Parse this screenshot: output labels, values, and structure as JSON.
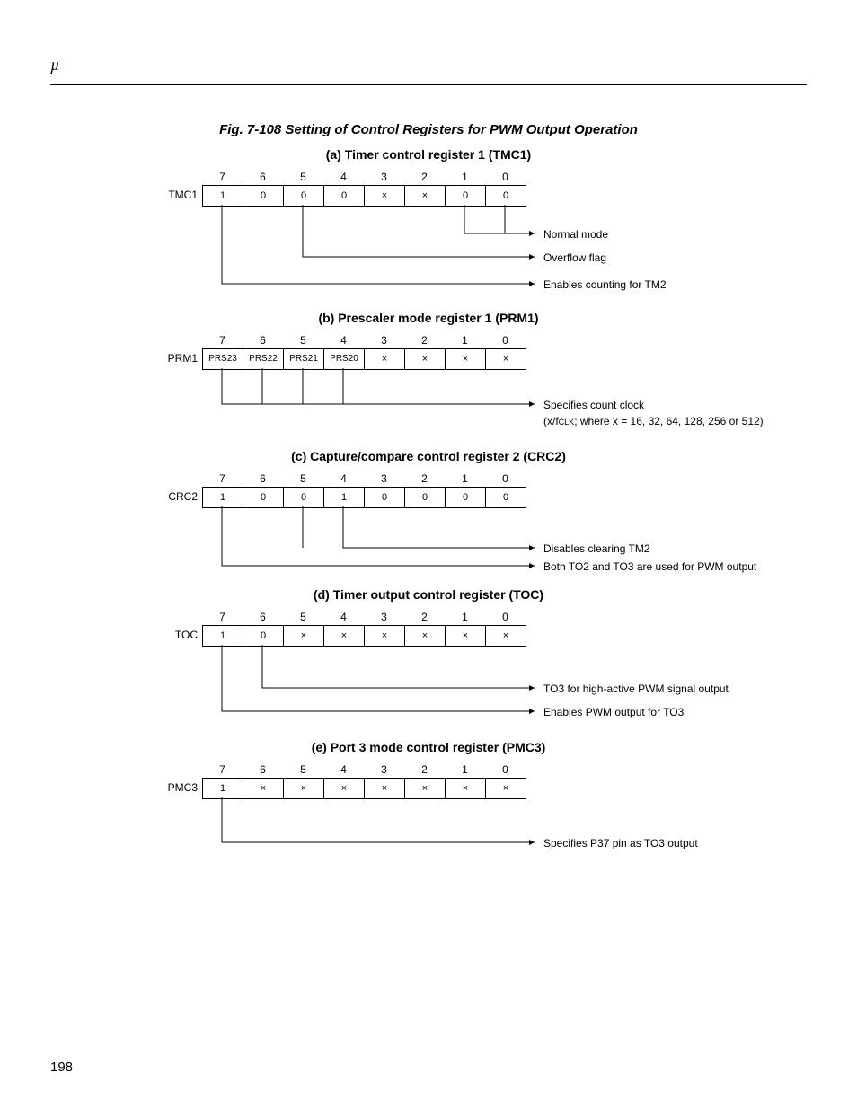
{
  "mu": "µ",
  "page_number": "198",
  "fig_title": "Fig. 7-108  Setting of Control Registers for PWM Output Operation",
  "sections": {
    "a": {
      "title": "(a)  Timer control register 1 (TMC1)",
      "label": "TMC1",
      "bitnums": [
        "7",
        "6",
        "5",
        "4",
        "3",
        "2",
        "1",
        "0"
      ],
      "cells": [
        "1",
        "0",
        "0",
        "0",
        "×",
        "×",
        "0",
        "0"
      ],
      "annots": [
        "Normal mode",
        "Overflow flag",
        "Enables counting for TM2"
      ]
    },
    "b": {
      "title": "(b)  Prescaler mode register 1 (PRM1)",
      "label": "PRM1",
      "bitnums": [
        "7",
        "6",
        "5",
        "4",
        "3",
        "2",
        "1",
        "0"
      ],
      "cells": [
        "PRS23",
        "PRS22",
        "PRS21",
        "PRS20",
        "×",
        "×",
        "×",
        "×"
      ],
      "annots": [
        "Specifies count clock"
      ],
      "annot_sub_prefix": "(x/f",
      "annot_sub_clk": "CLK",
      "annot_sub_suffix": "; where x = 16, 32, 64, 128, 256 or 512)"
    },
    "c": {
      "title": "(c)  Capture/compare control register 2 (CRC2)",
      "label": "CRC2",
      "bitnums": [
        "7",
        "6",
        "5",
        "4",
        "3",
        "2",
        "1",
        "0"
      ],
      "cells": [
        "1",
        "0",
        "0",
        "1",
        "0",
        "0",
        "0",
        "0"
      ],
      "annots": [
        "Disables clearing TM2",
        "Both TO2 and TO3 are used for PWM output"
      ]
    },
    "d": {
      "title": "(d)  Timer output control register (TOC)",
      "label": "TOC",
      "bitnums": [
        "7",
        "6",
        "5",
        "4",
        "3",
        "2",
        "1",
        "0"
      ],
      "cells": [
        "1",
        "0",
        "×",
        "×",
        "×",
        "×",
        "×",
        "×"
      ],
      "annots": [
        "TO3 for high-active PWM signal output",
        "Enables PWM output for TO3"
      ]
    },
    "e": {
      "title": "(e)  Port 3 mode control register (PMC3)",
      "label": "PMC3",
      "bitnums": [
        "7",
        "6",
        "5",
        "4",
        "3",
        "2",
        "1",
        "0"
      ],
      "cells": [
        "1",
        "×",
        "×",
        "×",
        "×",
        "×",
        "×",
        "×"
      ],
      "annots": [
        "Specifies P37 pin as TO3 output"
      ]
    }
  }
}
